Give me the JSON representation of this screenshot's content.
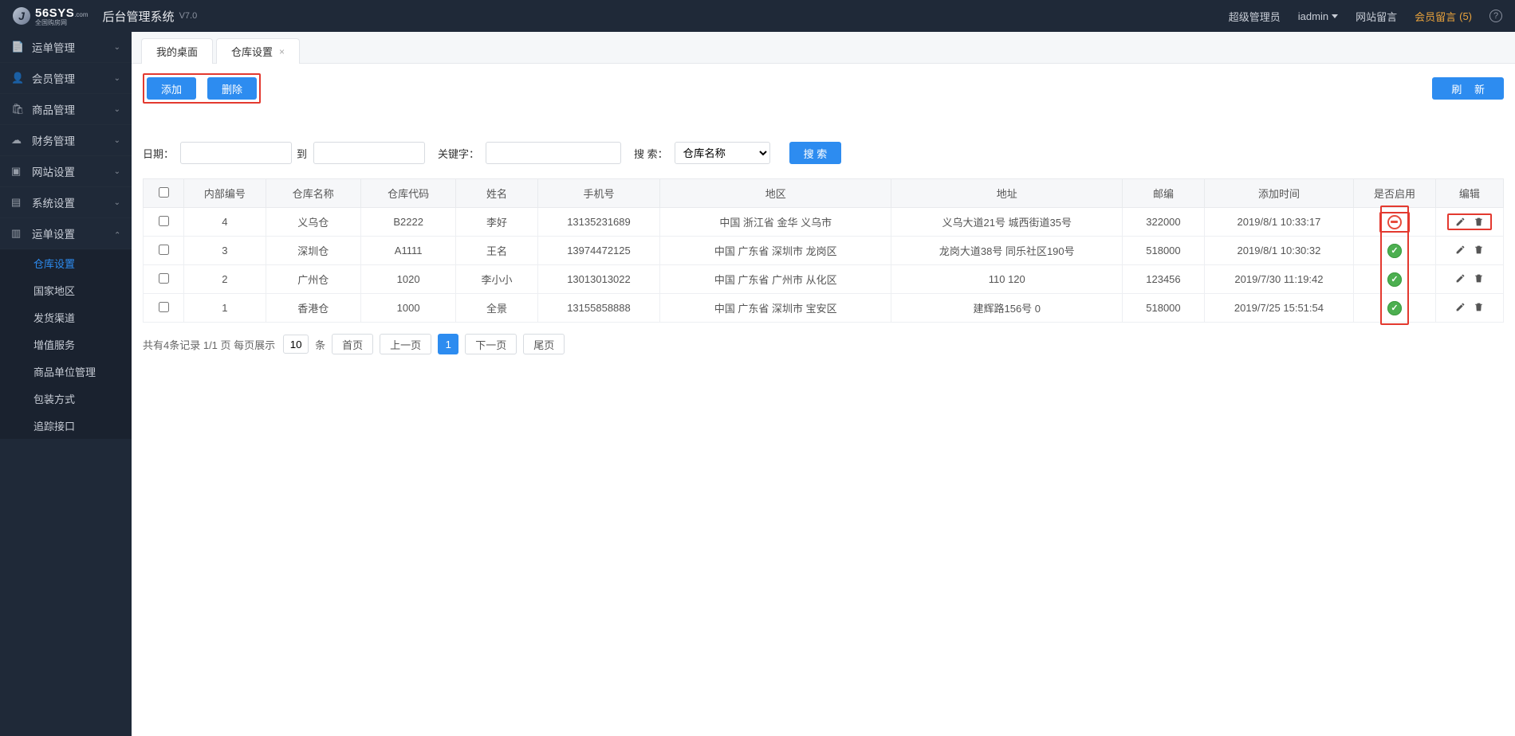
{
  "header": {
    "logo_main": "56SYS",
    "logo_sub_top": "全国购房网",
    "logo_sub_bot": ".com",
    "system_title": "后台管理系统",
    "version": "V7.0",
    "role": "超级管理员",
    "user": "iadmin",
    "link_site_msg": "网站留言",
    "link_member_msg": "会员留言",
    "member_msg_count": "(5)"
  },
  "sidebar": {
    "items": [
      {
        "icon": "📄",
        "label": "运单管理",
        "expanded": false
      },
      {
        "icon": "👤",
        "label": "会员管理",
        "expanded": false
      },
      {
        "icon": "🛍",
        "label": "商品管理",
        "expanded": false
      },
      {
        "icon": "☁",
        "label": "财务管理",
        "expanded": false
      },
      {
        "icon": "▣",
        "label": "网站设置",
        "expanded": false
      },
      {
        "icon": "▤",
        "label": "系统设置",
        "expanded": false
      },
      {
        "icon": "▥",
        "label": "运单设置",
        "expanded": true
      }
    ],
    "sub_items": [
      {
        "label": "仓库设置",
        "active": true
      },
      {
        "label": "国家地区"
      },
      {
        "label": "发货渠道"
      },
      {
        "label": "增值服务"
      },
      {
        "label": "商品单位管理"
      },
      {
        "label": "包装方式"
      },
      {
        "label": "追踪接口"
      }
    ]
  },
  "tabs": [
    {
      "label": "我的桌面",
      "closable": false
    },
    {
      "label": "仓库设置",
      "closable": true,
      "active": true
    }
  ],
  "toolbar": {
    "add": "添加",
    "delete": "删除",
    "refresh": "刷 新"
  },
  "filters": {
    "date_label": "日期：",
    "to_label": "到",
    "keyword_label": "关键字：",
    "search_label": "搜 索：",
    "search_type_selected": "仓库名称",
    "search_btn": "搜 索"
  },
  "table": {
    "headers": [
      "",
      "内部编号",
      "仓库名称",
      "仓库代码",
      "姓名",
      "手机号",
      "地区",
      "地址",
      "邮编",
      "添加时间",
      "是否启用",
      "编辑"
    ],
    "rows": [
      {
        "id": "4",
        "name": "义乌仓",
        "code": "B2222",
        "person": "李好",
        "phone": "13135231689",
        "region": "中国 浙江省 金华 义乌市",
        "address": "义乌大道21号 城西街道35号",
        "zip": "322000",
        "time": "2019/8/1 10:33:17",
        "enabled": false,
        "edit_highlight": true
      },
      {
        "id": "3",
        "name": "深圳仓",
        "code": "A1111",
        "person": "王名",
        "phone": "13974472125",
        "region": "中国 广东省 深圳市 龙岗区",
        "address": "龙岗大道38号 同乐社区190号",
        "zip": "518000",
        "time": "2019/8/1 10:30:32",
        "enabled": true
      },
      {
        "id": "2",
        "name": "广州仓",
        "code": "1020",
        "person": "李小小",
        "phone": "13013013022",
        "region": "中国 广东省 广州市 从化区",
        "address": "110 120",
        "zip": "123456",
        "time": "2019/7/30 11:19:42",
        "enabled": true
      },
      {
        "id": "1",
        "name": "香港仓",
        "code": "1000",
        "person": "全景",
        "phone": "13155858888",
        "region": "中国 广东省 深圳市 宝安区",
        "address": "建辉路156号 0",
        "zip": "518000",
        "time": "2019/7/25 15:51:54",
        "enabled": true
      }
    ]
  },
  "pager": {
    "summary": "共有4条记录  1/1 页  每页展示",
    "page_size": "10",
    "unit": "条",
    "first": "首页",
    "prev": "上一页",
    "current": "1",
    "next": "下一页",
    "last": "尾页"
  }
}
